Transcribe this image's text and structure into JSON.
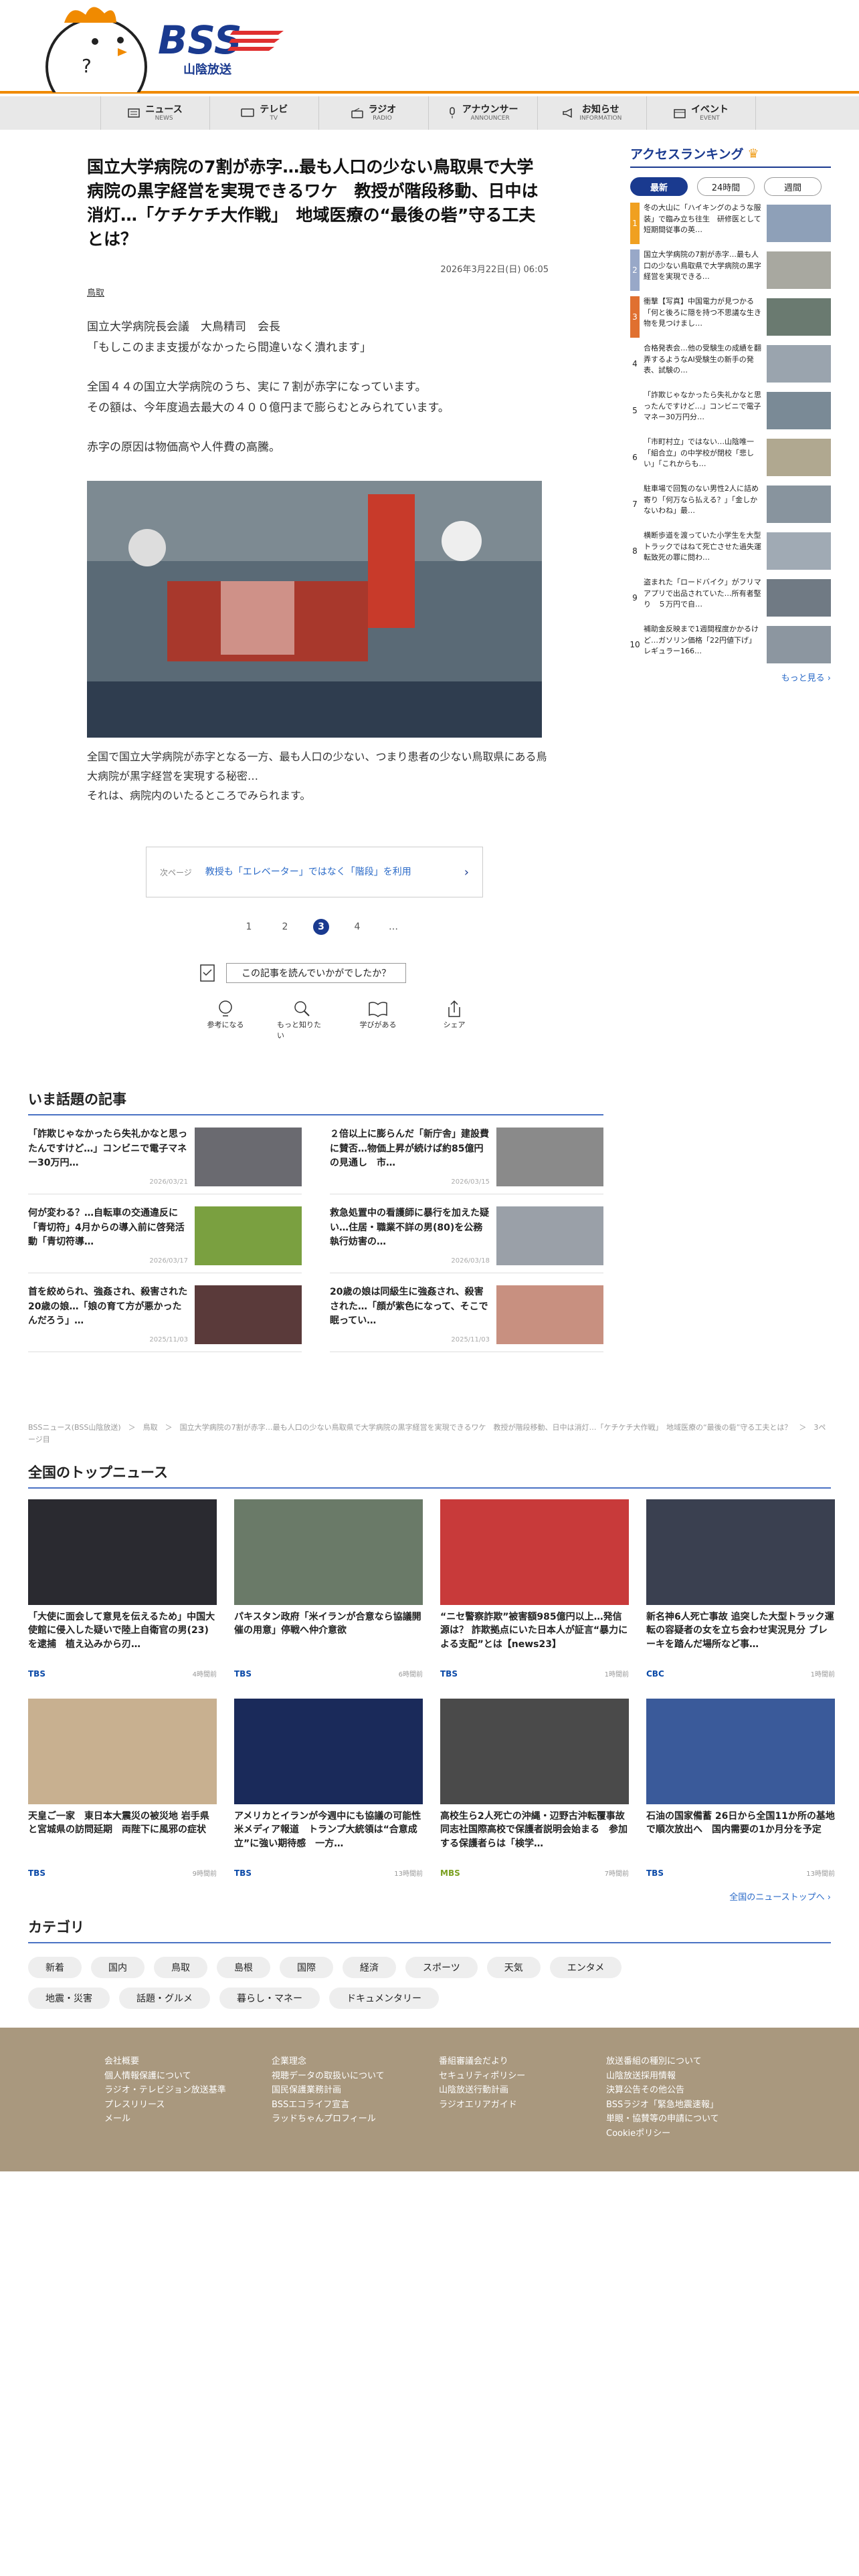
{
  "site": {
    "logo_text": "BSS",
    "logo_sub": "山陰放送"
  },
  "nav": [
    {
      "jp": "ニュース",
      "en": "NEWS"
    },
    {
      "jp": "テレビ",
      "en": "TV"
    },
    {
      "jp": "ラジオ",
      "en": "RADIO"
    },
    {
      "jp": "アナウンサー",
      "en": "ANNOUNCER"
    },
    {
      "jp": "お知らせ",
      "en": "INFORMATION"
    },
    {
      "jp": "イベント",
      "en": "EVENT"
    }
  ],
  "article": {
    "title": "国立大学病院の7割が赤字…最も人口の少ない鳥取県で大学病院の黒字経営を実現できるワケ　教授が階段移動、日中は消灯…「ケチケチ大作戦」　地域医療の“最後の砦”守る工夫とは？",
    "date": "2026年3月22日(日) 06:05",
    "category": "鳥取",
    "p1": "国立大学病院長会議　大鳥精司　会長",
    "p2": "「もしこのまま支援がなかったら間違いなく潰れます」",
    "p3": "全国４４の国立大学病院のうち、実に７割が赤字になっています。",
    "p4": "その額は、今年度過去最大の４００億円まで膨らむとみられています。",
    "p5": "赤字の原因は物価高や人件費の高騰。",
    "p6": "全国で国立大学病院が赤字となる一方、最も人口の少ない、つまり患者の少ない鳥取県にある鳥大病院が黒字経営を実現する秘密…",
    "p7": "それは、病院内のいたるところでみられます。",
    "next_label": "次ページ",
    "next_text": "教授も「エレベーター」ではなく「階段」を利用",
    "pages": [
      "1",
      "2",
      "3",
      "4",
      "…"
    ],
    "current_page": "3",
    "feedback_q": "この記事を読んでいかがでしたか？",
    "reactions": [
      "参考になる",
      "もっと知りたい",
      "学びがある",
      "シェア"
    ]
  },
  "ranking": {
    "title": "アクセスランキング",
    "tabs": [
      "最新",
      "24時間",
      "週間"
    ],
    "items": [
      {
        "n": "1",
        "t": "冬の大山に「ハイキングのような服装」で臨み立ち往生　研修医として短期間従事の英…",
        "c": "#f0a020"
      },
      {
        "n": "2",
        "t": "国立大学病院の7割が赤字…最も人口の少ない鳥取県で大学病院の黒字経営を実現できる…",
        "c": "#98a8c8"
      },
      {
        "n": "3",
        "t": "衝撃【写真】中国電力が見つかる「何と後ろに隠を持つ不思議な生き物を見つけまし…",
        "c": "#e07030"
      },
      {
        "n": "4",
        "t": "合格発表会…他の受験生の成績を翻弄するようなAI受験生の新手の発表、試験の…",
        "c": "#fff"
      },
      {
        "n": "5",
        "t": "「詐欺じゃなかったら失礼かなと思ったんですけど…」コンビニで電子マネー30万円分…",
        "c": "#fff"
      },
      {
        "n": "6",
        "t": "「市町村立」ではない…山陰唯一「組合立」の中学校が閉校「悲しい」「これからも…",
        "c": "#fff"
      },
      {
        "n": "7",
        "t": "駐車場で回覧のない男性2人に詰め寄り「何万なら払える？」「金しかないわね」最…",
        "c": "#fff"
      },
      {
        "n": "8",
        "t": "横断歩道を渡っていた小学生を大型トラックではねて死亡させた過失運転致死の罪に問わ…",
        "c": "#fff"
      },
      {
        "n": "9",
        "t": "盗まれた「ロードバイク」がフリマアプリで出品されていた…所有者堅り　５万円で自…",
        "c": "#fff"
      },
      {
        "n": "10",
        "t": "補助金反映まで1週間程度かかるけど…ガソリン価格「22円値下げ」レギュラー166…",
        "c": "#fff"
      }
    ],
    "more": "もっと見る"
  },
  "topics": {
    "title": "いま話題の記事",
    "items": [
      {
        "t": "「詐欺じゃなかったら失礼かなと思ったんですけど…」コンビニで電子マネー30万円…",
        "d": "2026/03/21"
      },
      {
        "t": "２倍以上に膨らんだ「新庁舎」建設費に賛否…物価上昇が続けば約85億円の見通し　市…",
        "d": "2026/03/15"
      },
      {
        "t": "何が変わる？…自転車の交通違反に「青切符」4月からの導入前に啓発活動「青切符導…",
        "d": "2026/03/17"
      },
      {
        "t": "救急処置中の看護師に暴行を加えた疑い…住居・職業不詳の男(80)を公務執行妨害の…",
        "d": "2026/03/18"
      },
      {
        "t": "首を絞められ、強姦され、殺害された20歳の娘…「娘の育て方が悪かったんだろう」…",
        "d": "2025/11/03"
      },
      {
        "t": "20歳の娘は同級生に強姦され、殺害された…「顔が紫色になって、そこで眠ってい…",
        "d": "2025/11/03"
      }
    ]
  },
  "breadcrumb": "BSSニュース(BSS山陰放送)　＞　鳥取　＞　国立大学病院の7割が赤字…最も人口の少ない鳥取県で大学病院の黒字経営を実現できるワケ　教授が階段移動、日中は消灯…「ケチケチ大作戦」　地域医療の“最後の砦”守る工夫とは？　＞　3ページ目",
  "top_news": {
    "title": "全国のトップニュース",
    "items": [
      {
        "t": "「大使に面会して意見を伝えるため」中国大使館に侵入した疑いで陸上自衛官の男(23)を逮捕　植え込みから刃…",
        "s": "TBS",
        "a": "4時間前"
      },
      {
        "t": "パキスタン政府「米イランが合意なら協議開催の用意」停戦へ仲介意欲",
        "s": "TBS",
        "a": "6時間前"
      },
      {
        "t": "“ニセ警察詐欺”被害額985億円以上…発信源は？ 詐欺拠点にいた日本人が証言“暴力による支配”とは【news23】",
        "s": "TBS",
        "a": "1時間前"
      },
      {
        "t": "新名神6人死亡事故 追突した大型トラック運転の容疑者の女を立ち会わせ実況見分 ブレーキを踏んだ場所など事…",
        "s": "CBC",
        "a": "1時間前"
      },
      {
        "t": "天皇ご一家　東日本大震災の被災地 岩手県と宮城県の訪問延期　両陛下に風邪の症状",
        "s": "TBS",
        "a": "9時間前"
      },
      {
        "t": "アメリカとイランが今週中にも協議の可能性 米メディア報道　トランプ大統領は“合意成立”に強い期待感　一方…",
        "s": "TBS",
        "a": "13時間前"
      },
      {
        "t": "高校生ら2人死亡の沖縄・辺野古沖転覆事故　同志社国際高校で保護者説明会始まる　参加する保護者らは「検学…",
        "s": "MBS",
        "a": "7時間前"
      },
      {
        "t": "石油の国家備蓄 26日から全国11か所の基地で順次放出へ　国内需要の1か月分を予定",
        "s": "TBS",
        "a": "13時間前"
      }
    ],
    "more": "全国のニューストップへ"
  },
  "categories": {
    "title": "カテゴリ",
    "items": [
      "新着",
      "国内",
      "鳥取",
      "島根",
      "国際",
      "経済",
      "スポーツ",
      "天気",
      "エンタメ",
      "地震・災害",
      "話題・グルメ",
      "暮らし・マネー",
      "ドキュメンタリー"
    ]
  },
  "footer": {
    "cols": [
      [
        "会社概要",
        "個人情報保護について",
        "ラジオ・テレビジョン放送基準",
        "プレスリリース",
        "メール"
      ],
      [
        "企業理念",
        "視聴データの取扱いについて",
        "国民保護業務計画",
        "BSSエコライフ宣言",
        "ラッドちゃんプロフィール"
      ],
      [
        "番組審議会だより",
        "セキュリティポリシー",
        "山陰放送行動計画",
        "ラジオエリアガイド"
      ],
      [
        "放送番組の種別について",
        "山陰放送採用情報",
        "決算公告その他公告",
        "BSSラジオ「緊急地震速報」",
        "単眼・協賛等の申請について",
        "Cookieポリシー"
      ]
    ]
  },
  "colors": {
    "accent": "#f08a00",
    "navy": "#1a3a8f",
    "blue": "#4a72c4"
  }
}
